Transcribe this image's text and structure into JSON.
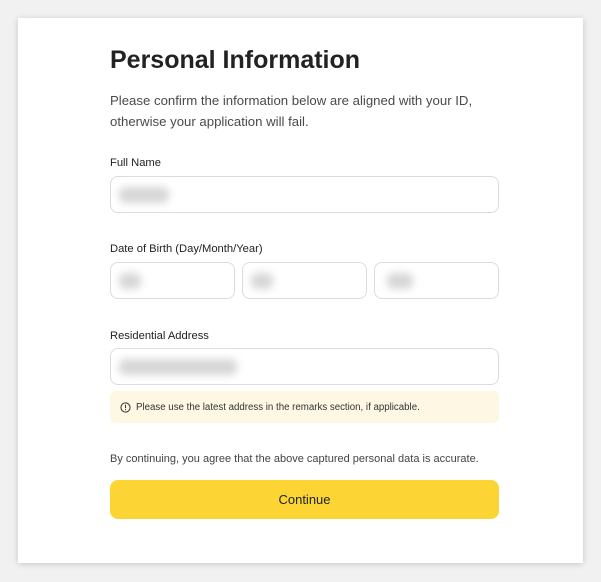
{
  "page": {
    "title": "Personal Information",
    "subtitle": "Please confirm the information below are aligned with your ID, otherwise your application will fail."
  },
  "form": {
    "full_name": {
      "label": "Full Name",
      "value": ""
    },
    "date_of_birth": {
      "label": "Date of Birth (Day/Month/Year)",
      "day": "",
      "month": "",
      "year": ""
    },
    "residential_address": {
      "label": "Residential Address",
      "value": ""
    },
    "address_notice": "Please use the latest address in the remarks section, if applicable."
  },
  "footer": {
    "consent_text": "By continuing, you agree that the above captured personal data is accurate.",
    "continue_label": "Continue"
  },
  "icons": {
    "notice_icon": "info-circle-icon"
  },
  "colors": {
    "accent": "#fcd535",
    "notice_background": "#fdf7e3",
    "input_border": "#dcdcdc"
  }
}
